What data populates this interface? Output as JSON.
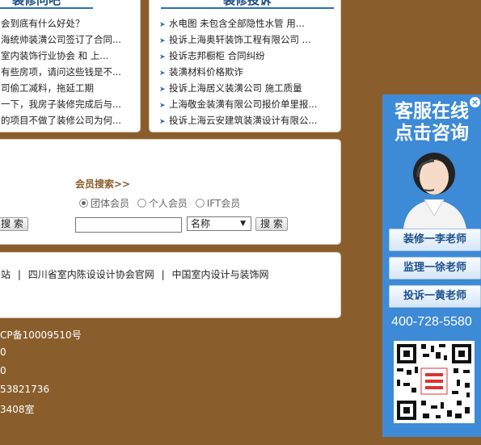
{
  "panels": {
    "left": {
      "title": "装修问吧",
      "items": [
        "会到底有什么好处？",
        "海统帅装潢公司签订了合同...",
        "室内装饰行业协会 和 上...",
        "有些房项，请问这些钱是不...",
        "司偷工减料，拖延工期",
        "一下，我房子装修完成后与...",
        "的项目不做了装修公司为何..."
      ]
    },
    "right": {
      "title": "装修投诉",
      "items": [
        "水电图 未包含全部隐性水管 用...",
        "投诉上海奥轩装饰工程有限公司 ...",
        "投诉志邦橱柜 合同纠纷",
        "装潢材料价格欺诈",
        "投诉上海居义装潢公司 施工质量",
        "上海敬金装潢有限公司报价单里报...",
        "投诉上海云安建筑装潢设计有限公..."
      ]
    }
  },
  "search": {
    "title": "会员搜索>>",
    "left_button": "搜 索",
    "radio_options": [
      "团体会员",
      "个人会员",
      "IFT会员"
    ],
    "selected_radio": "团体会员",
    "input_value": "",
    "select_value": "名称",
    "button": "搜 索"
  },
  "links": {
    "items": [
      "站",
      "四川省室内陈设设计协会官网",
      "中国室内设计与装饰网"
    ],
    "separator": "|"
  },
  "footer": {
    "lines": [
      "CP备10009510号",
      "0",
      "0",
      "53821736",
      "3408室"
    ]
  },
  "widget": {
    "title_line1": "客服在线",
    "title_line2": "点击咨询",
    "close": "×",
    "buttons": [
      "装修一李老师",
      "监理一徐老师",
      "投诉一黄老师"
    ],
    "phone": "400-728-5580"
  },
  "colors": {
    "background": "#8a5e2c",
    "widget": "#3d8ad6",
    "search_title": "#8a5e2c",
    "header_line": "#2a6fb0"
  }
}
